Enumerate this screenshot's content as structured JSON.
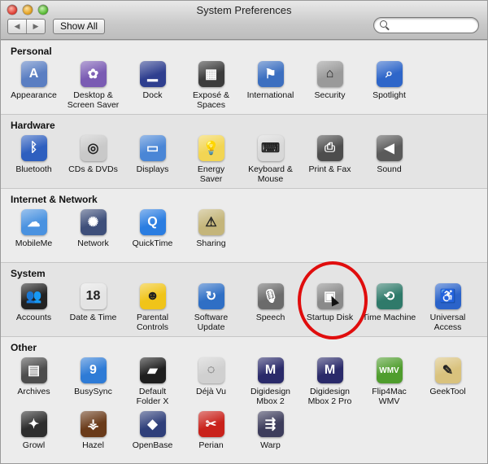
{
  "window": {
    "title": "System Preferences"
  },
  "toolbar": {
    "back_icon": "triangle-left-icon",
    "forward_icon": "triangle-right-icon",
    "show_all_label": "Show All",
    "search_value": "",
    "search_placeholder": ""
  },
  "sections": [
    {
      "title": "Personal",
      "items": [
        {
          "label": "Appearance",
          "icon": "appearance-icon",
          "color": "#5a7ec2"
        },
        {
          "label": "Desktop &\nScreen Saver",
          "icon": "desktop-icon",
          "color": "#7a5bb3"
        },
        {
          "label": "Dock",
          "icon": "dock-icon",
          "color": "#2f3f8f"
        },
        {
          "label": "Exposé &\nSpaces",
          "icon": "expose-icon",
          "color": "#3c3c3c"
        },
        {
          "label": "International",
          "icon": "flag-icon",
          "color": "#3c6fc0"
        },
        {
          "label": "Security",
          "icon": "house-lock-icon",
          "color": "#9a9a9a"
        },
        {
          "label": "Spotlight",
          "icon": "magnifier-icon",
          "color": "#2e66c9"
        }
      ]
    },
    {
      "title": "Hardware",
      "items": [
        {
          "label": "Bluetooth",
          "icon": "bluetooth-icon",
          "color": "#2e5fbf"
        },
        {
          "label": "CDs & DVDs",
          "icon": "disc-icon",
          "color": "#c9c9c9"
        },
        {
          "label": "Displays",
          "icon": "display-icon",
          "color": "#4a86d6"
        },
        {
          "label": "Energy\nSaver",
          "icon": "lightbulb-icon",
          "color": "#f2d553"
        },
        {
          "label": "Keyboard &\nMouse",
          "icon": "keyboard-icon",
          "color": "#d8d8d8"
        },
        {
          "label": "Print & Fax",
          "icon": "printer-icon",
          "color": "#4d4d4d"
        },
        {
          "label": "Sound",
          "icon": "speaker-icon",
          "color": "#5a5a5a"
        }
      ]
    },
    {
      "title": "Internet & Network",
      "items": [
        {
          "label": "MobileMe",
          "icon": "cloud-icon",
          "color": "#4a92e0"
        },
        {
          "label": "Network",
          "icon": "globe-icon",
          "color": "#3e4f7a"
        },
        {
          "label": "QuickTime",
          "icon": "quicktime-icon",
          "color": "#2a7de1"
        },
        {
          "label": "Sharing",
          "icon": "folder-sharing-icon",
          "color": "#c4b57a"
        }
      ]
    },
    {
      "title": "System",
      "items": [
        {
          "label": "Accounts",
          "icon": "accounts-icon",
          "color": "#222222"
        },
        {
          "label": "Date & Time",
          "icon": "clock-calendar-icon",
          "color": "#e4e4e4"
        },
        {
          "label": "Parental\nControls",
          "icon": "parental-icon",
          "color": "#f0c419"
        },
        {
          "label": "Software\nUpdate",
          "icon": "update-icon",
          "color": "#2f6fc5"
        },
        {
          "label": "Speech",
          "icon": "microphone-icon",
          "color": "#6b6b6b"
        },
        {
          "label": "Startup Disk",
          "icon": "hard-disk-icon",
          "color": "#8a8a8a"
        },
        {
          "label": "Time Machine",
          "icon": "time-machine-icon",
          "color": "#2f7a6a"
        },
        {
          "label": "Universal\nAccess",
          "icon": "accessibility-icon",
          "color": "#2b63c9"
        }
      ]
    },
    {
      "title": "Other",
      "items": [
        {
          "label": "Archives",
          "icon": "archives-icon",
          "color": "#4d4d4d"
        },
        {
          "label": "BusySync",
          "icon": "calendar-icon",
          "color": "#2e7bd6"
        },
        {
          "label": "Default\nFolder X",
          "icon": "folder-x-icon",
          "color": "#1f1f1f"
        },
        {
          "label": "Déjà Vu",
          "icon": "dejavu-icon",
          "color": "#d0d0d0"
        },
        {
          "label": "Digidesign\nMbox 2",
          "icon": "mbox-icon",
          "color": "#2a2a6a"
        },
        {
          "label": "Digidesign\nMbox 2 Pro",
          "icon": "mbox-pro-icon",
          "color": "#2a2a6a"
        },
        {
          "label": "Flip4Mac\nWMV",
          "icon": "wmv-icon",
          "color": "#4f9d2d"
        },
        {
          "label": "GeekTool",
          "icon": "geektool-icon",
          "color": "#d9c27d"
        },
        {
          "label": "Growl",
          "icon": "growl-icon",
          "color": "#2d2d2d"
        },
        {
          "label": "Hazel",
          "icon": "broom-icon",
          "color": "#6a3b1a"
        },
        {
          "label": "OpenBase",
          "icon": "cube-icon",
          "color": "#2f3f7a"
        },
        {
          "label": "Perian",
          "icon": "knife-icon",
          "color": "#c9221b"
        },
        {
          "label": "Warp",
          "icon": "warp-icon",
          "color": "#3d3d5c"
        }
      ]
    }
  ]
}
